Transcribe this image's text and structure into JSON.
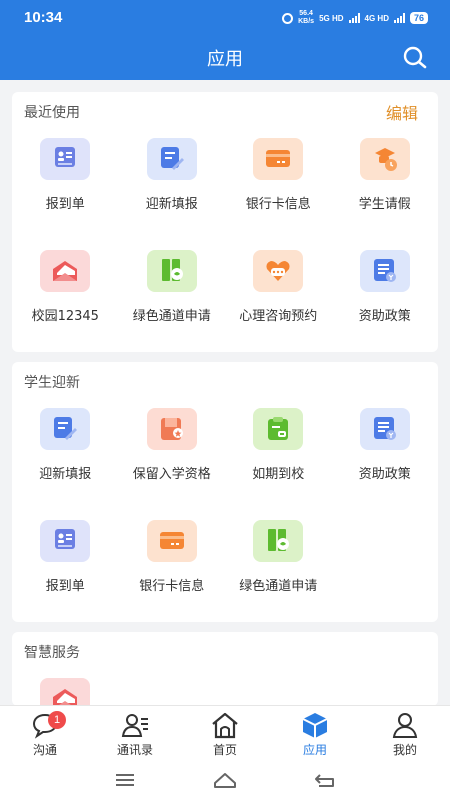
{
  "status": {
    "time": "10:34",
    "net_speed": "56.4",
    "net_unit": "KB/s",
    "sim1": "5G HD",
    "sim2": "4G HD",
    "battery": "76"
  },
  "header": {
    "title": "应用"
  },
  "recent": {
    "title": "最近使用",
    "edit": "编辑",
    "items": [
      {
        "label": "报到单",
        "icon": "report-card-icon"
      },
      {
        "label": "迎新填报",
        "icon": "edit-form-icon"
      },
      {
        "label": "银行卡信息",
        "icon": "bank-card-icon"
      },
      {
        "label": "学生请假",
        "icon": "student-leave-icon"
      },
      {
        "label": "校园12345",
        "icon": "envelope-icon"
      },
      {
        "label": "绿色通道申请",
        "icon": "green-channel-icon"
      },
      {
        "label": "心理咨询预约",
        "icon": "heart-chat-icon"
      },
      {
        "label": "资助政策",
        "icon": "finance-policy-icon"
      }
    ]
  },
  "welcome": {
    "title": "学生迎新",
    "items": [
      {
        "label": "迎新填报",
        "icon": "edit-form-icon"
      },
      {
        "label": "保留入学资格",
        "icon": "folder-star-icon"
      },
      {
        "label": "如期到校",
        "icon": "clipboard-icon"
      },
      {
        "label": "资助政策",
        "icon": "finance-policy-icon"
      },
      {
        "label": "报到单",
        "icon": "report-card-icon"
      },
      {
        "label": "银行卡信息",
        "icon": "bank-card-icon"
      },
      {
        "label": "绿色通道申请",
        "icon": "green-channel-icon"
      }
    ]
  },
  "smart": {
    "title": "智慧服务",
    "items": [
      {
        "icon": "envelope-icon"
      }
    ]
  },
  "tabbar": {
    "items": [
      {
        "label": "沟通",
        "icon": "chat-icon",
        "badge": "1"
      },
      {
        "label": "通讯录",
        "icon": "contacts-icon"
      },
      {
        "label": "首页",
        "icon": "home-icon"
      },
      {
        "label": "应用",
        "icon": "apps-cube-icon",
        "active": true
      },
      {
        "label": "我的",
        "icon": "profile-icon"
      }
    ]
  },
  "colors": {
    "primary": "#2a7de1",
    "accent": "#e0902a",
    "badge": "#ef4b4b"
  }
}
